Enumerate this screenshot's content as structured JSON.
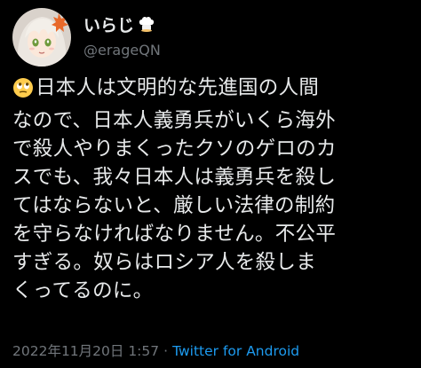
{
  "author": {
    "display_name": "いらじ",
    "badge_icon": "chef-hat-emoji",
    "handle": "@erageQN",
    "avatar_icon": "anime-girl-avatar"
  },
  "tweet": {
    "lead_emoji_icon": "face-with-rolling-eyes-emoji",
    "lines": [
      "日本人は文明的な先進国の人間",
      "なので、日本人義勇兵がいくら海外",
      "で殺人やりまくったクソのゲロのカ",
      "スでも、我々日本人は義勇兵を殺し",
      "てはならないと、厳しい法律の制約",
      "を守らなければなりません。不公平",
      "すぎる。奴らはロシア人を殺しま",
      "くってるのに。"
    ]
  },
  "meta": {
    "timestamp": "2022年11月20日 1:57",
    "separator": "·",
    "source": "Twitter for Android"
  },
  "colors": {
    "background": "#000000",
    "text": "#e7e9ea",
    "secondary": "#71767b",
    "link": "#1d9bf0"
  }
}
